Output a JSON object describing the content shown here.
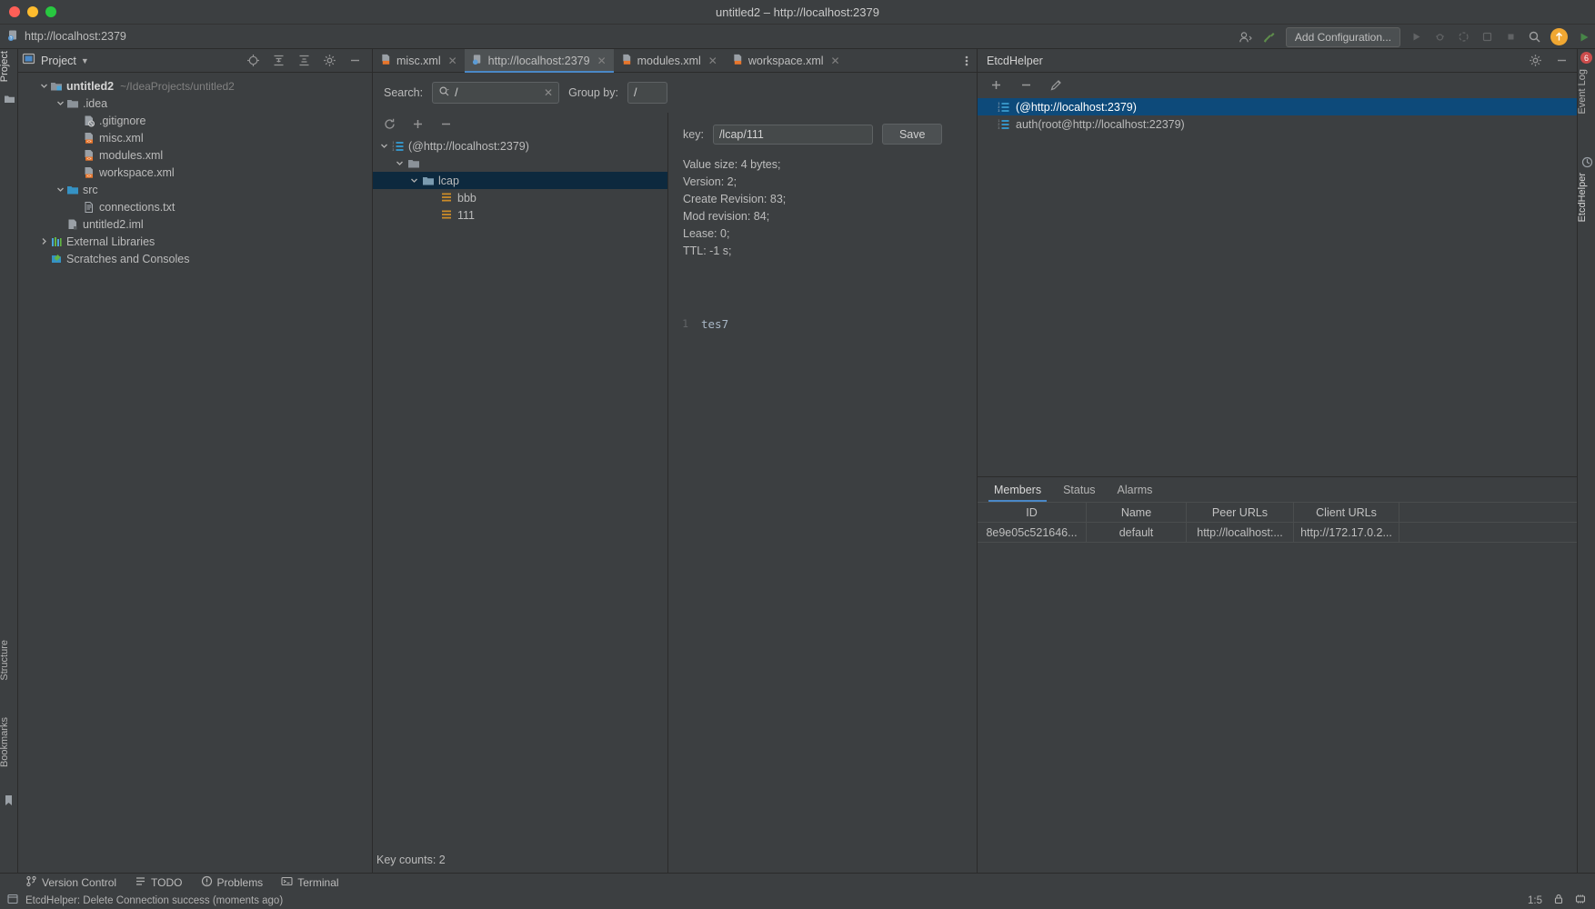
{
  "window": {
    "title": "untitled2 – http://localhost:2379",
    "breadcrumb": "http://localhost:2379"
  },
  "navbar": {
    "add_configuration": "Add Configuration...",
    "icons": [
      "user-icon",
      "build-icon",
      "run-icon",
      "debug-icon",
      "profile-icon",
      "stop-icon",
      "search-everywhere-icon",
      "update-icon",
      "run-green-icon"
    ]
  },
  "left_strip": {
    "project_label": "Project",
    "structure_label": "Structure",
    "bookmarks_label": "Bookmarks"
  },
  "right_strip": {
    "event_log_label": "Event Log",
    "etcd_helper_label": "EtcdHelper",
    "badge": "6"
  },
  "project_panel": {
    "title": "Project",
    "tools": [
      "locate-icon",
      "expand-all-icon",
      "collapse-all-icon",
      "gear-icon",
      "hide-icon"
    ],
    "tree": [
      {
        "label": "untitled2",
        "path": "~/IdeaProjects/untitled2",
        "depth": 0,
        "arrow": "down",
        "icon": "module-icon",
        "bold": true
      },
      {
        "label": ".idea",
        "path": "",
        "depth": 1,
        "arrow": "down",
        "icon": "folder-grey-icon",
        "bold": false
      },
      {
        "label": ".gitignore",
        "path": "",
        "depth": 2,
        "arrow": "none",
        "icon": "gitignore-icon",
        "bold": false
      },
      {
        "label": "misc.xml",
        "path": "",
        "depth": 2,
        "arrow": "none",
        "icon": "xml-icon",
        "bold": false
      },
      {
        "label": "modules.xml",
        "path": "",
        "depth": 2,
        "arrow": "none",
        "icon": "xml-icon",
        "bold": false
      },
      {
        "label": "workspace.xml",
        "path": "",
        "depth": 2,
        "arrow": "none",
        "icon": "xml-icon",
        "bold": false
      },
      {
        "label": "src",
        "path": "",
        "depth": 1,
        "arrow": "down",
        "icon": "folder-blue-icon",
        "bold": false
      },
      {
        "label": "connections.txt",
        "path": "",
        "depth": 2,
        "arrow": "none",
        "icon": "text-icon",
        "bold": false
      },
      {
        "label": "untitled2.iml",
        "path": "",
        "depth": 1,
        "arrow": "none",
        "icon": "iml-icon",
        "bold": false
      },
      {
        "label": "External Libraries",
        "path": "",
        "depth": 0,
        "arrow": "right",
        "icon": "libraries-icon",
        "bold": false
      },
      {
        "label": "Scratches and Consoles",
        "path": "",
        "depth": 0,
        "arrow": "none",
        "icon": "scratches-icon",
        "bold": false
      }
    ]
  },
  "editor": {
    "tabs": [
      {
        "label": "misc.xml",
        "icon": "xml-icon",
        "active": false
      },
      {
        "label": "http://localhost:2379",
        "icon": "etcd-icon",
        "active": true
      },
      {
        "label": "modules.xml",
        "icon": "xml-icon",
        "active": false
      },
      {
        "label": "workspace.xml",
        "icon": "xml-icon",
        "active": false
      }
    ],
    "search_label": "Search:",
    "search_value": "/",
    "groupby_label": "Group by:",
    "groupby_value": "/",
    "keytree_tools": [
      "refresh-icon",
      "add-icon",
      "remove-icon"
    ],
    "keytree": [
      {
        "label": "(@http://localhost:2379)",
        "depth": 0,
        "arrow": "down",
        "icon": "etcd-list-icon",
        "selected": false
      },
      {
        "label": "",
        "depth": 1,
        "arrow": "down",
        "icon": "folder-grey-icon",
        "selected": false
      },
      {
        "label": "lcap",
        "depth": 2,
        "arrow": "down",
        "icon": "folder-blue-icon",
        "selected": true
      },
      {
        "label": "bbb",
        "depth": 3,
        "arrow": "none",
        "icon": "key-icon",
        "selected": false
      },
      {
        "label": "111",
        "depth": 3,
        "arrow": "none",
        "icon": "key-icon",
        "selected": false
      }
    ],
    "key_counts": "Key counts: 2",
    "key_label": "key:",
    "key_value": "/lcap/111",
    "save_label": "Save",
    "metadata": [
      "Value size: 4 bytes;",
      "Version: 2;",
      "Create Revision: 83;",
      "Mod revision: 84;",
      "Lease: 0;",
      "TTL: -1 s;"
    ],
    "value_line_number": "1",
    "value_content": "tes7"
  },
  "etcd_helper": {
    "title": "EtcdHelper",
    "head_tools": [
      "gear-icon",
      "hide-icon"
    ],
    "conn_tools": [
      "add-icon",
      "remove-icon",
      "edit-icon"
    ],
    "connections": [
      {
        "label": "(@http://localhost:2379)",
        "icon": "etcd-list-icon",
        "selected": true
      },
      {
        "label": "auth(root@http://localhost:22379)",
        "icon": "etcd-list-icon",
        "selected": false
      }
    ],
    "tabs": [
      {
        "label": "Members",
        "active": true
      },
      {
        "label": "Status",
        "active": false
      },
      {
        "label": "Alarms",
        "active": false
      }
    ],
    "members_columns": [
      "ID",
      "Name",
      "Peer URLs",
      "Client URLs"
    ],
    "members_rows": [
      [
        "8e9e05c521646...",
        "default",
        "http://localhost:...",
        "http://172.17.0.2..."
      ]
    ]
  },
  "bottom_bar": {
    "items": [
      {
        "label": "Version Control",
        "icon": "vcs-icon"
      },
      {
        "label": "TODO",
        "icon": "todo-icon"
      },
      {
        "label": "Problems",
        "icon": "problems-icon"
      },
      {
        "label": "Terminal",
        "icon": "terminal-icon"
      }
    ]
  },
  "status_bar": {
    "message": "EtcdHelper: Delete Connection success (moments ago)",
    "caret": "1:5",
    "icons": [
      "lock-icon",
      "memory-icon"
    ]
  },
  "colors": {
    "accent_blue": "#4a88c7",
    "selection_blue": "#0d4a7a",
    "tree_selection": "#0d293e",
    "background": "#3c3f41",
    "key_orange": "#cc8c29"
  }
}
